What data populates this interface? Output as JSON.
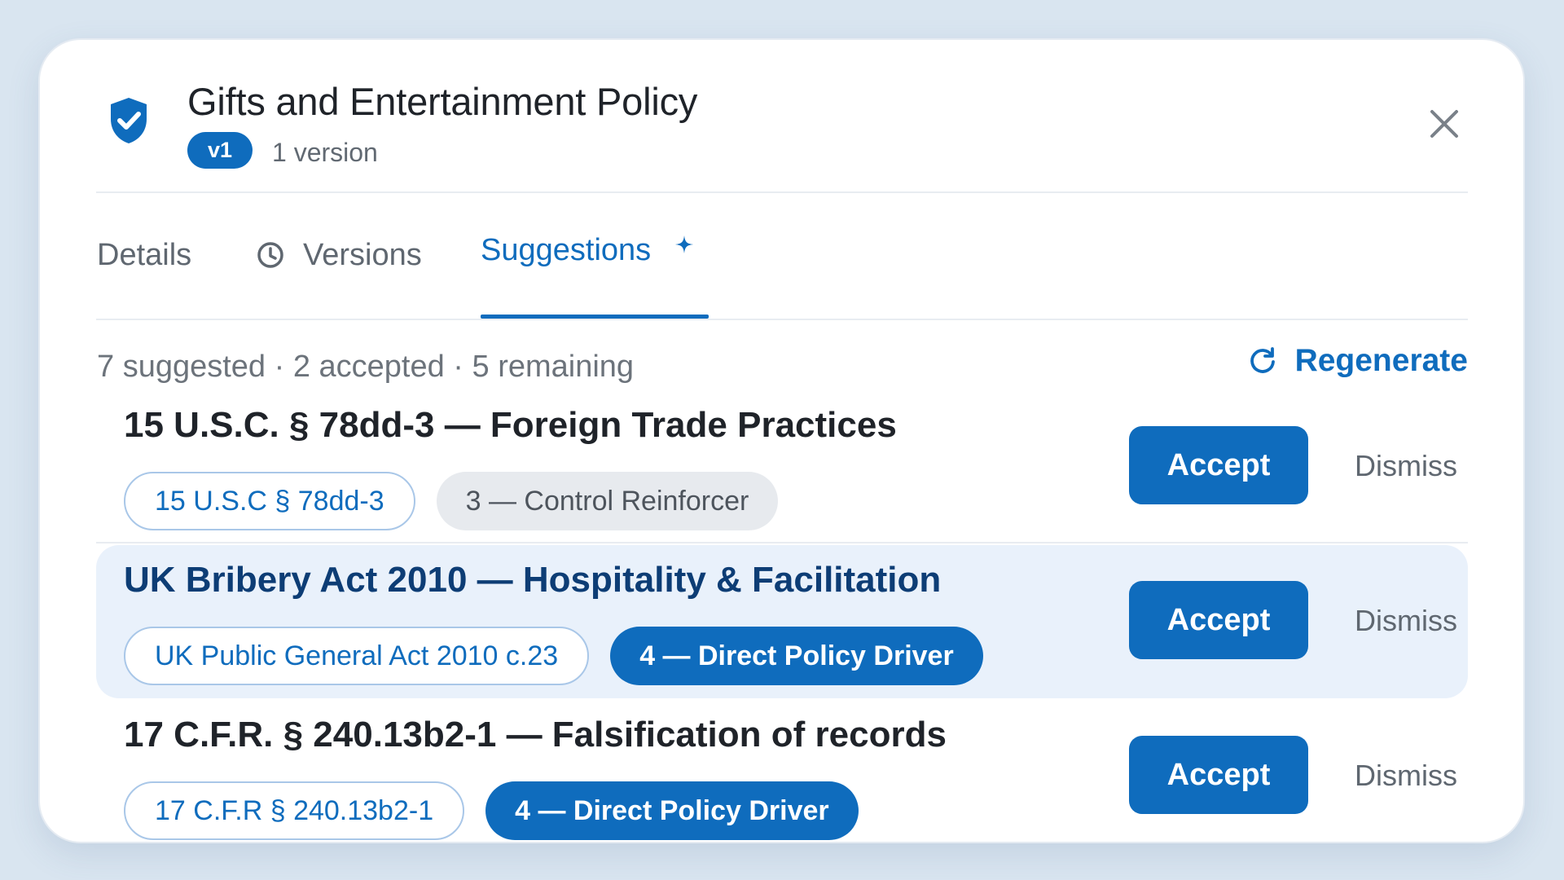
{
  "header": {
    "title": "Gifts and Entertainment Policy",
    "version_badge": "v1",
    "version_count": "1 version",
    "icon": "shield-check-icon",
    "close_icon": "close-icon"
  },
  "tabs": [
    {
      "label": "Details"
    },
    {
      "label": "Versions",
      "icon": "clock-icon"
    },
    {
      "label": "Suggestions",
      "icon": "sparkle-icon",
      "active": true
    }
  ],
  "summary": "7 suggested · 2 accepted · 5 remaining",
  "regenerate_label": "Regenerate",
  "suggestions": [
    {
      "title": "15 U.S.C. § 78dd-3 — Foreign Trade Practices",
      "citation": "15 U.S.C § 78dd-3",
      "rank": "3 — Control Reinforcer",
      "accept": "Accept",
      "dismiss": "Dismiss"
    },
    {
      "title": "UK Bribery Act 2010 — Hospitality & Facilitation",
      "citation": "UK Public General Act 2010 c.23",
      "rank": "4 — Direct Policy Driver",
      "accept": "Accept",
      "dismiss": "Dismiss"
    },
    {
      "title": "17 C.F.R. § 240.13b2-1 — Falsification of records",
      "citation": "17 C.F.R § 240.13b2-1",
      "rank": "4 — Direct Policy Driver",
      "accept": "Accept",
      "dismiss": "Dismiss"
    }
  ],
  "colors": {
    "accent": "#0f6cbd",
    "highlight_row": "#e9f1fb",
    "background": "#d9e5f0"
  }
}
